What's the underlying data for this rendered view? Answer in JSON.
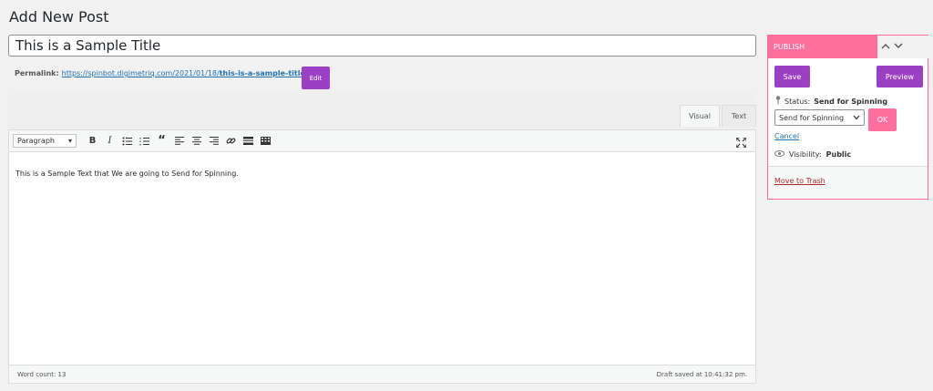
{
  "page": {
    "title": "Add New Post"
  },
  "post": {
    "title": "This is a Sample Title"
  },
  "permalink": {
    "label": "Permalink:",
    "base": "https://spinbot.digimetriq.com/2021/01/18/",
    "slug": "this-is-a-sample-title",
    "trailing": "/",
    "edit_label": "Edit"
  },
  "editor": {
    "tabs": {
      "visual": "Visual",
      "text": "Text"
    },
    "format_select": "Paragraph",
    "content": "This is a Sample Text that We are going to Send for Spinning.",
    "word_count": "Word count: 13",
    "draft_saved": "Draft saved at 10:41:32 pm."
  },
  "publish": {
    "header": "PUBLISH",
    "save_label": "Save",
    "preview_label": "Preview",
    "status_label": "Status:",
    "status_value": "Send for Spinning",
    "status_select": "Send for Spinning",
    "ok_label": "OK",
    "cancel_label": "Cancel",
    "visibility_label": "Visibility:",
    "visibility_value": "Public",
    "trash_label": "Move to Trash"
  },
  "colors": {
    "accent_purple": "#9b3fc4",
    "accent_pink": "#ff6f9e",
    "link_blue": "#2271b1",
    "trash_red": "#b32d2e"
  }
}
